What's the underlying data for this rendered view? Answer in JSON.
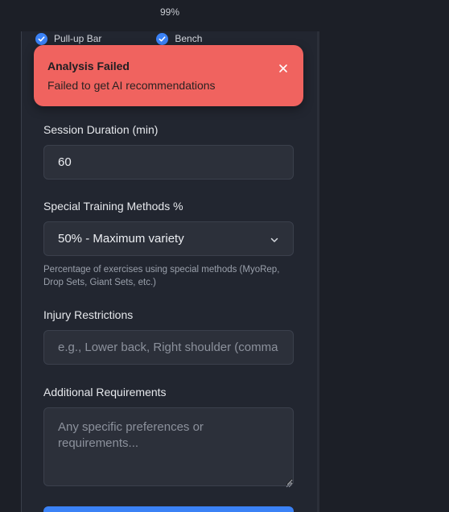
{
  "zoom_level": "99%",
  "equipment": [
    {
      "label": "Pull-up Bar",
      "checked": true
    },
    {
      "label": "Bench",
      "checked": true
    }
  ],
  "toast": {
    "title": "Analysis Failed",
    "message": "Failed to get AI recommendations",
    "close_icon": "close-icon",
    "color": "#f0635f"
  },
  "session_duration": {
    "label": "Session Duration (min)",
    "value": "60"
  },
  "special_methods": {
    "label": "Special Training Methods %",
    "selected": "50% - Maximum variety",
    "help": "Percentage of exercises using special methods (MyoRep, Drop Sets, Giant Sets, etc.)"
  },
  "injury": {
    "label": "Injury Restrictions",
    "placeholder": "e.g., Lower back, Right shoulder (comma"
  },
  "additional": {
    "label": "Additional Requirements",
    "placeholder": "Any specific preferences or requirements..."
  },
  "colors": {
    "accent": "#3b82f6",
    "background": "#222630"
  }
}
